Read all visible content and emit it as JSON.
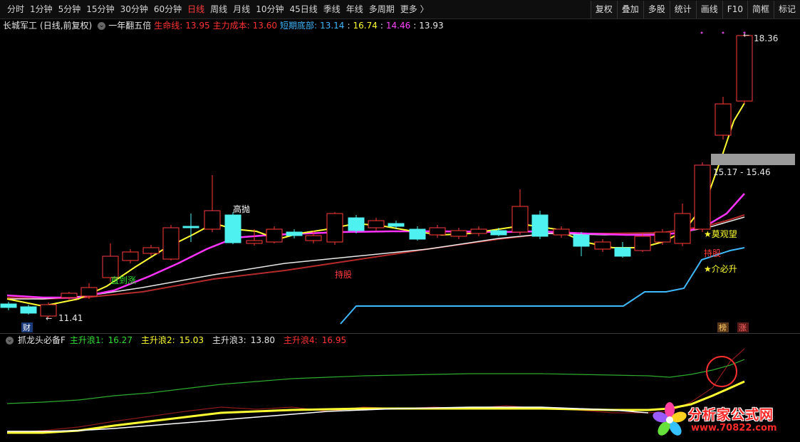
{
  "toolbar": {
    "periods": [
      "分时",
      "1分钟",
      "5分钟",
      "15分钟",
      "30分钟",
      "60分钟",
      "日线",
      "周线",
      "月线",
      "10分钟",
      "45日线",
      "季线",
      "年线",
      "多周期",
      "更多 〉"
    ],
    "active": "日线",
    "buttons": [
      "复权",
      "叠加",
      "多股",
      "统计",
      "画线",
      "F10",
      "简框",
      "标记"
    ]
  },
  "header": {
    "stock_name": "长城军工",
    "stock_info": "(日线,前复权)",
    "indicator_name": "一年翻五倍",
    "shengming_label": "生命线:",
    "shengming_value": "13.95",
    "zhuli_label": "主力成本:",
    "zhuli_value": "13.60",
    "duanqi_label": "短期底部:",
    "v1": "13.14",
    "v2": "16.74",
    "v3": "14.46",
    "v4": "13.93"
  },
  "chart_labels": {
    "high_price": "18.36",
    "low_price": "11.41",
    "range_box": "15.17 - 15.46",
    "gaopao": "高抛",
    "zhidaozhang": "直到涨",
    "chigu_main": "持股",
    "chigu_right": "持股",
    "moguanwang": "★莫观望",
    "jiebisheng": "★介必升",
    "cai": "财",
    "bang": "榜",
    "zhang": "涨"
  },
  "sub_header": {
    "name": "抓龙头必备F",
    "w1_label": "主升浪1:",
    "w1_value": "16.27",
    "w2_label": "主升浪2:",
    "w2_value": "15.03",
    "w3_label": "主升浪3:",
    "w3_value": "13.80",
    "w4_label": "主升浪4:",
    "w4_value": "16.95"
  },
  "watermark": {
    "title": "分析家公式网",
    "url": "www.70822.com"
  },
  "colors": {
    "up": "#ff3b3b",
    "down": "#4ef0f0",
    "yellow": "#ffff33",
    "magenta": "#ff33ff",
    "cyan": "#3fb8ff",
    "darkred": "#c0392b",
    "green": "#2eaa2e"
  }
}
